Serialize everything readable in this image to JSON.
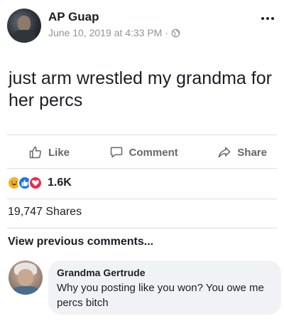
{
  "post": {
    "author": "AP Guap",
    "timestamp": "June 10, 2019 at 4:33 PM",
    "separator": "·",
    "privacy_icon": "globe-icon",
    "more_icon": "more-dots-icon",
    "text": "just arm wrestled my grandma for her percs"
  },
  "actions": {
    "like_label": "Like",
    "comment_label": "Comment",
    "share_label": "Share"
  },
  "reactions": {
    "icons": [
      "haha-icon",
      "like-icon",
      "love-icon"
    ],
    "count": "1.6K"
  },
  "shares": "19,747 Shares",
  "comments": {
    "view_previous": "View previous comments...",
    "items": [
      {
        "author": "Grandma Gertrude",
        "text": "Why you posting like you won? You owe me percs bitch"
      }
    ]
  },
  "colors": {
    "text": "#1c1e21",
    "muted": "#8d949e",
    "action": "#65676b",
    "like_blue": "#1877f2",
    "love_red": "#f02849",
    "haha_yellow": "#f7b125",
    "bubble": "#f0f2f5"
  }
}
